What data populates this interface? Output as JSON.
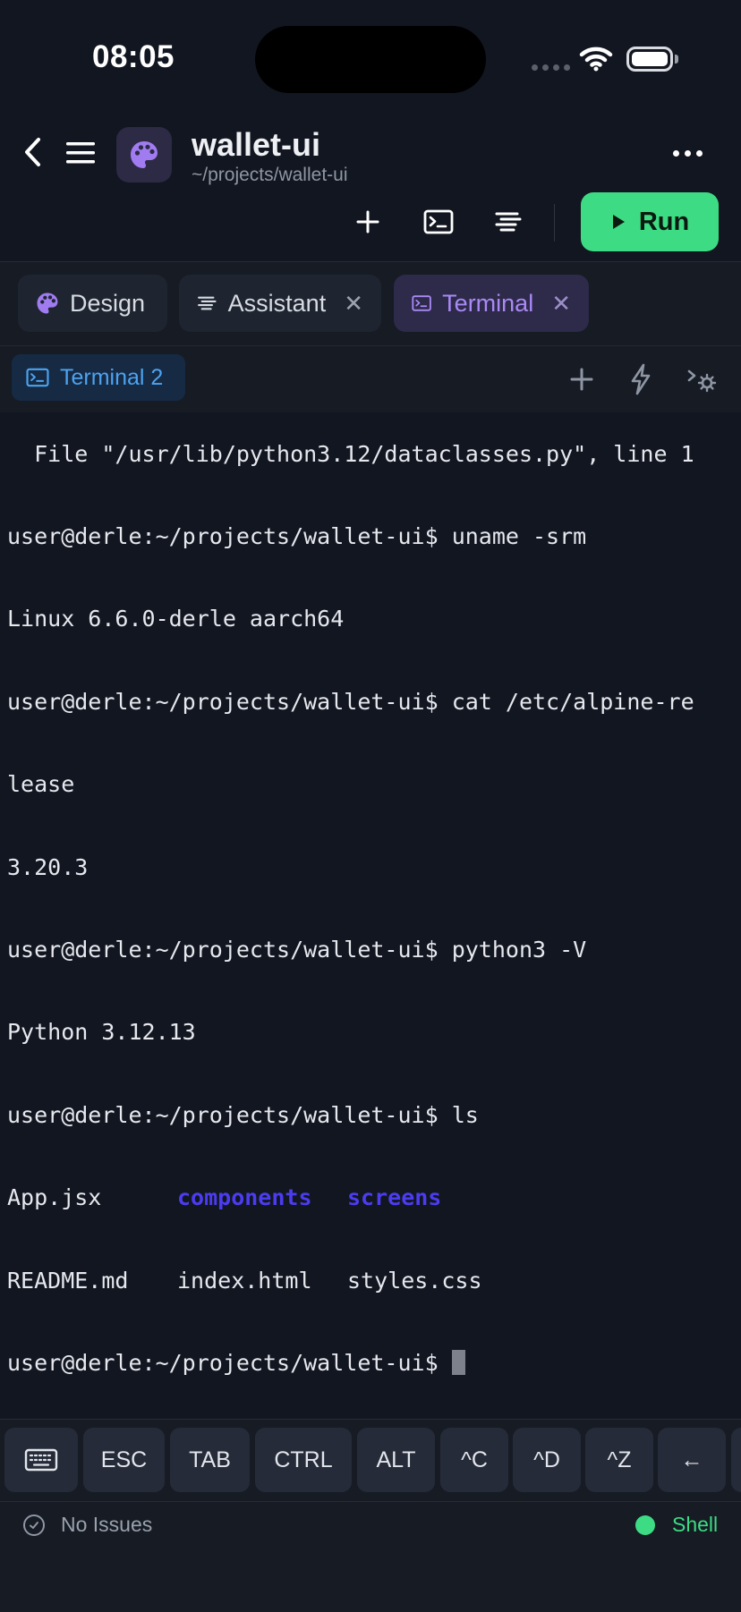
{
  "status_bar": {
    "time": "08:05"
  },
  "project": {
    "name": "wallet-ui",
    "path": "~/projects/wallet-ui"
  },
  "toolbar": {
    "run_label": "Run"
  },
  "tabs": [
    {
      "label": "Design",
      "icon": "palette-icon",
      "closable": false
    },
    {
      "label": "Assistant",
      "icon": "lines-icon",
      "closable": true
    },
    {
      "label": "Terminal",
      "icon": "terminal-icon",
      "closable": true,
      "active": true
    }
  ],
  "tab_close_glyph": "✕",
  "subtab": {
    "label": "Terminal 2"
  },
  "terminal": {
    "lines": [
      "  File \"/usr/lib/python3.12/dataclasses.py\", line 1",
      "user@derle:~/projects/wallet-ui$ uname -srm",
      "Linux 6.6.0-derle aarch64",
      "user@derle:~/projects/wallet-ui$ cat /etc/alpine-re",
      "lease",
      "3.20.3",
      "user@derle:~/projects/wallet-ui$ python3 -V",
      "Python 3.12.13",
      "user@derle:~/projects/wallet-ui$ ls"
    ],
    "ls_row1": {
      "file": "App.jsx",
      "dir1": "components",
      "dir2": "screens"
    },
    "ls_row2": {
      "file1": "README.md",
      "file2": "index.html",
      "file3": "styles.css"
    },
    "prompt": "user@derle:~/projects/wallet-ui$ "
  },
  "keys": [
    "ESC",
    "TAB",
    "CTRL",
    "ALT",
    "^C",
    "^D",
    "^Z",
    "←"
  ],
  "bottom": {
    "issues_label": "No Issues",
    "shell_label": "Shell"
  },
  "colors": {
    "accent_green": "#3ddc84",
    "accent_purple": "#a989f5",
    "directory_blue": "#4b3cf0"
  }
}
